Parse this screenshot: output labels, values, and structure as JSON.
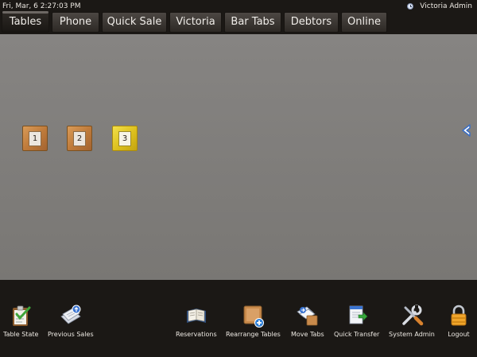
{
  "status": {
    "datetime": "Fri, Mar, 6  2:27:03 PM",
    "user": "Victoria Admin",
    "clock_icon": "clock-icon"
  },
  "tabs": [
    {
      "label": "Tables",
      "active": true
    },
    {
      "label": "Phone"
    },
    {
      "label": "Quick Sale"
    },
    {
      "label": "Victoria"
    },
    {
      "label": "Bar Tabs"
    },
    {
      "label": "Debtors"
    },
    {
      "label": "Online"
    }
  ],
  "floor": {
    "tables": [
      {
        "number": "1",
        "state": "free"
      },
      {
        "number": "2",
        "state": "free"
      },
      {
        "number": "3",
        "state": "selected"
      }
    ],
    "collapse_icon": "chevron-left-icon"
  },
  "toolbar": {
    "left": [
      {
        "label": "Table State",
        "icon": "clipboard-check-icon"
      },
      {
        "label": "Previous Sales",
        "icon": "receipts-icon"
      }
    ],
    "right": [
      {
        "label": "Reservations",
        "icon": "book-icon"
      },
      {
        "label": "Rearrange Tables",
        "icon": "table-add-icon"
      },
      {
        "label": "Move Tabs",
        "icon": "move-tabs-icon"
      },
      {
        "label": "Quick Transfer",
        "icon": "transfer-icon"
      },
      {
        "label": "System Admin",
        "icon": "tools-icon"
      },
      {
        "label": "Logout",
        "icon": "padlock-icon"
      }
    ]
  },
  "colors": {
    "chrome": "#1b1815",
    "floor": "#807e7c",
    "table_wood": "#c7843f",
    "table_selected": "#e6c829"
  }
}
